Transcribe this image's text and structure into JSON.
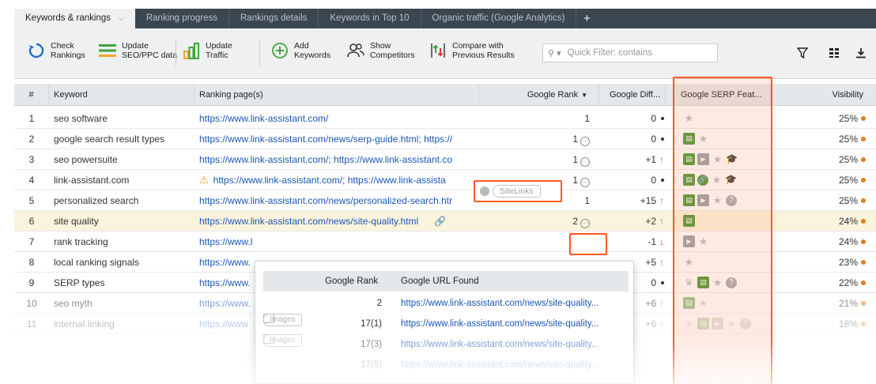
{
  "tabs": [
    {
      "label": "Keywords & rankings",
      "active": true
    },
    {
      "label": "Ranking progress",
      "active": false
    },
    {
      "label": "Rankings details",
      "active": false
    },
    {
      "label": "Keywords in Top 10",
      "active": false
    },
    {
      "label": "Organic traffic (Google Analytics)",
      "active": false
    }
  ],
  "tab_add": "+",
  "toolbar": {
    "check_rankings": "Check\nRankings",
    "update_seo": "Update\nSEO/PPC data",
    "update_traffic": "Update\nTraffic",
    "add_keywords": "Add\nKeywords",
    "show_competitors": "Show\nCompetitors",
    "compare": "Compare with\nPrevious Results",
    "quick_filter_placeholder": "Quick Filter: contains"
  },
  "columns": {
    "num": "#",
    "keyword": "Keyword",
    "ranking_pages": "Ranking page(s)",
    "google_rank": "Google Rank",
    "google_diff": "Google Diff...",
    "serp_features": "Google SERP Feat...",
    "visibility": "Visibility"
  },
  "rows": [
    {
      "num": "1",
      "keyword": "seo software",
      "url": "https://www.link-assistant.com/",
      "rank": "1",
      "diff": "0",
      "trend": "none",
      "serp": [
        "star"
      ],
      "vis": "25%"
    },
    {
      "num": "2",
      "keyword": "google search result types",
      "url": "https://www.link-assistant.com/news/serp-guide.html; https://",
      "rank": "1",
      "diff": "0",
      "trend": "none",
      "serp": [
        "img",
        "star"
      ],
      "vis": "25%"
    },
    {
      "num": "3",
      "keyword": "seo powersuite",
      "url": "https://www.link-assistant.com/; https://www.link-assistant.co",
      "rank": "1",
      "diff": "+1",
      "trend": "up",
      "serp": [
        "img",
        "vid",
        "star",
        "hat"
      ],
      "vis": "25%"
    },
    {
      "num": "4",
      "keyword": "link-assistant.com",
      "url": "https://www.link-assistant.com/; https://www.link-assista",
      "rank": "1",
      "diff": "0",
      "trend": "none",
      "serp": [
        "img",
        "link",
        "star",
        "hat"
      ],
      "vis": "25%"
    },
    {
      "num": "5",
      "keyword": "personalized search",
      "url": "https://www.link-assistant.com/news/personalized-search.htr",
      "rank": "1",
      "diff": "+15",
      "trend": "up",
      "serp": [
        "img",
        "vid",
        "star",
        "q"
      ],
      "vis": "25%"
    },
    {
      "num": "6",
      "keyword": "site quality",
      "url": "https://www.link-assistant.com/news/site-quality.html",
      "rank": "2",
      "diff": "+2",
      "trend": "up",
      "serp": [
        "img"
      ],
      "vis": "24%"
    },
    {
      "num": "7",
      "keyword": "rank tracking",
      "url": "https://www.l",
      "rank": "",
      "diff": "-1",
      "trend": "down",
      "serp": [
        "vid",
        "star"
      ],
      "vis": "24%"
    },
    {
      "num": "8",
      "keyword": "local ranking signals",
      "url": "https://www.",
      "rank": "",
      "diff": "+5",
      "trend": "up",
      "serp": [
        "star"
      ],
      "vis": "23%"
    },
    {
      "num": "9",
      "keyword": "SERP types",
      "url": "https://www.",
      "rank": "",
      "diff": "0",
      "trend": "none",
      "serp": [
        "crown",
        "img",
        "star",
        "q"
      ],
      "vis": "22%"
    },
    {
      "num": "10",
      "keyword": "seo myth",
      "url": "https://www.",
      "rank": "",
      "diff": "+6",
      "trend": "up",
      "serp": [
        "img",
        "star"
      ],
      "vis": "21%"
    },
    {
      "num": "11",
      "keyword": "internal linking",
      "url": "https://www",
      "rank": "",
      "diff": "+6",
      "trend": "up",
      "serp": [
        "crown",
        "img",
        "vid",
        "star",
        "q"
      ],
      "vis": "18%"
    }
  ],
  "sitelinks_badge": "SiteLinks",
  "popup": {
    "col_rank": "Google Rank",
    "col_url": "Google URL Found",
    "rows": [
      {
        "feature": "",
        "rank": "2",
        "url": "https://www.link-assistant.com/news/site-quality..."
      },
      {
        "feature": "Images",
        "rank": "17(1)",
        "url": "https://www.link-assistant.com/news/site-quality..."
      },
      {
        "feature": "Images",
        "rank": "17(3)",
        "url": "https://www.link-assistant.com/news/site-quality..."
      },
      {
        "feature": "",
        "rank": "17(5)",
        "url": "https://www.link-assistant.com/news/site-quality..."
      }
    ]
  },
  "colors": {
    "accent": "#ff5a1f",
    "link": "#1a57b8",
    "tabbar": "#3a4650",
    "up": "#4caf50",
    "down": "#e53935",
    "visibility_dot": "#e57c1a"
  }
}
